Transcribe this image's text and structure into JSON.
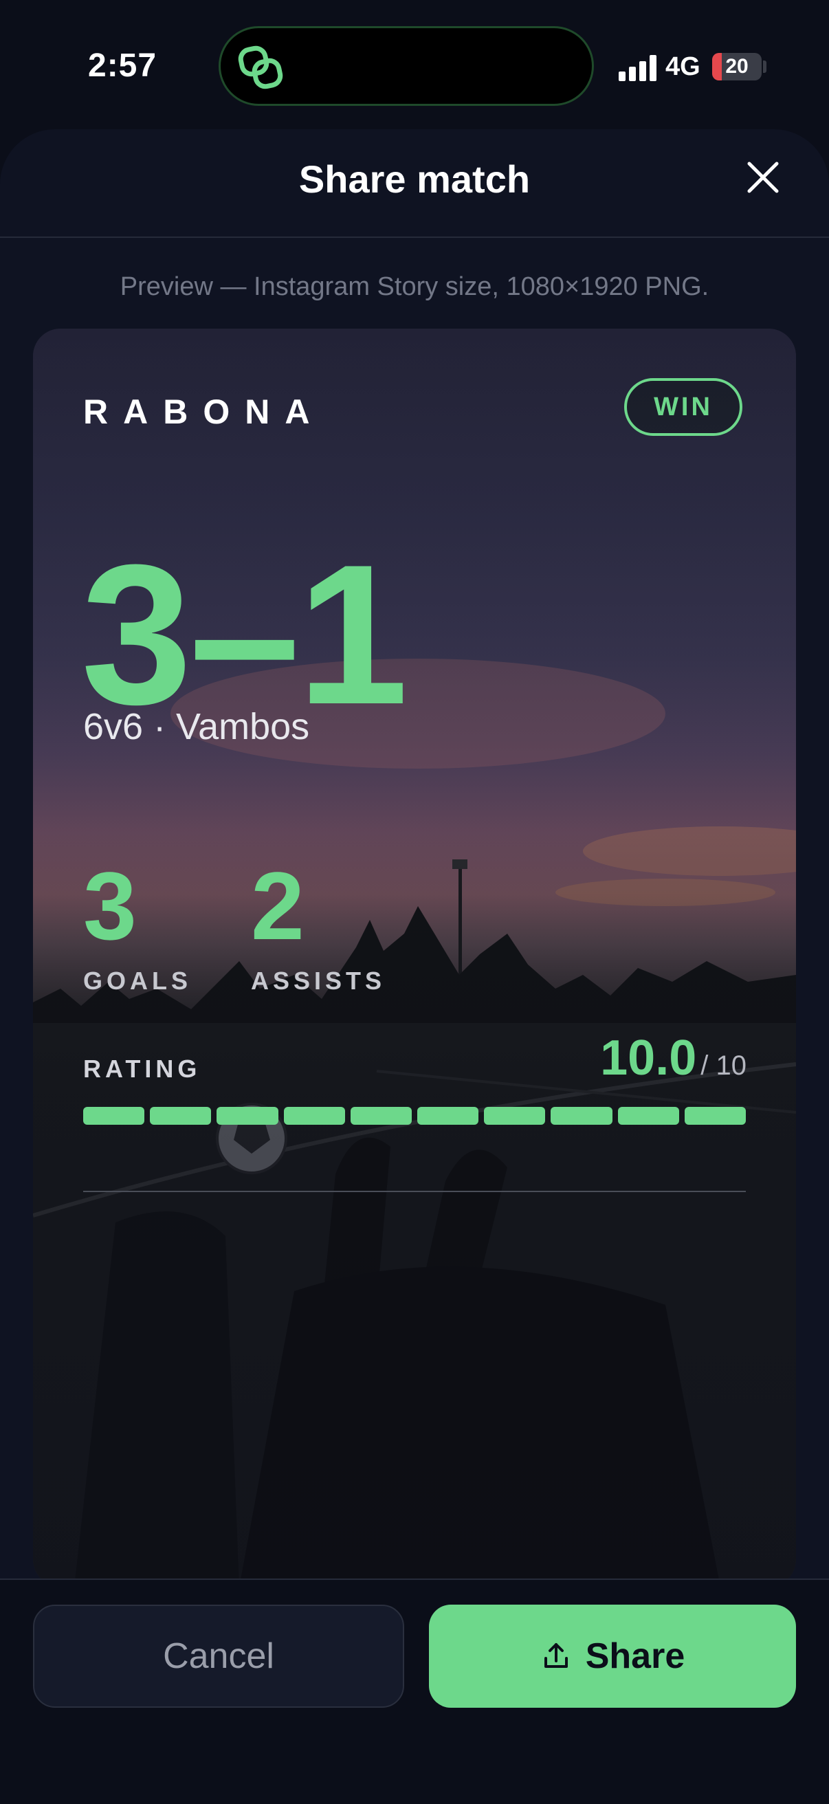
{
  "status_bar": {
    "time": "2:57",
    "network": "4G",
    "battery_level": "20",
    "battery_fraction": 0.2
  },
  "sheet": {
    "title": "Share match",
    "preview_note": "Preview — Instagram Story size, 1080×1920 PNG."
  },
  "card": {
    "brand": "RABONA",
    "result": "WIN",
    "score": "3–1",
    "match_info": "6v6 · Vambos",
    "stats": [
      {
        "value": "3",
        "label": "GOALS"
      },
      {
        "value": "2",
        "label": "ASSISTS"
      }
    ],
    "rating": {
      "label": "RATING",
      "value": "10.0",
      "max": "/ 10",
      "filled_segments": 10,
      "total_segments": 10
    }
  },
  "footer": {
    "cancel_label": "Cancel",
    "share_label": "Share"
  },
  "colors": {
    "accent": "#6dd88b",
    "background": "#0b0e19",
    "sheet": "#0f1322",
    "battery_low": "#e5484d"
  },
  "icons": {
    "island": "app-link-icon",
    "close": "close-icon",
    "share": "share-upload-icon",
    "signal": "signal-bars-icon"
  }
}
